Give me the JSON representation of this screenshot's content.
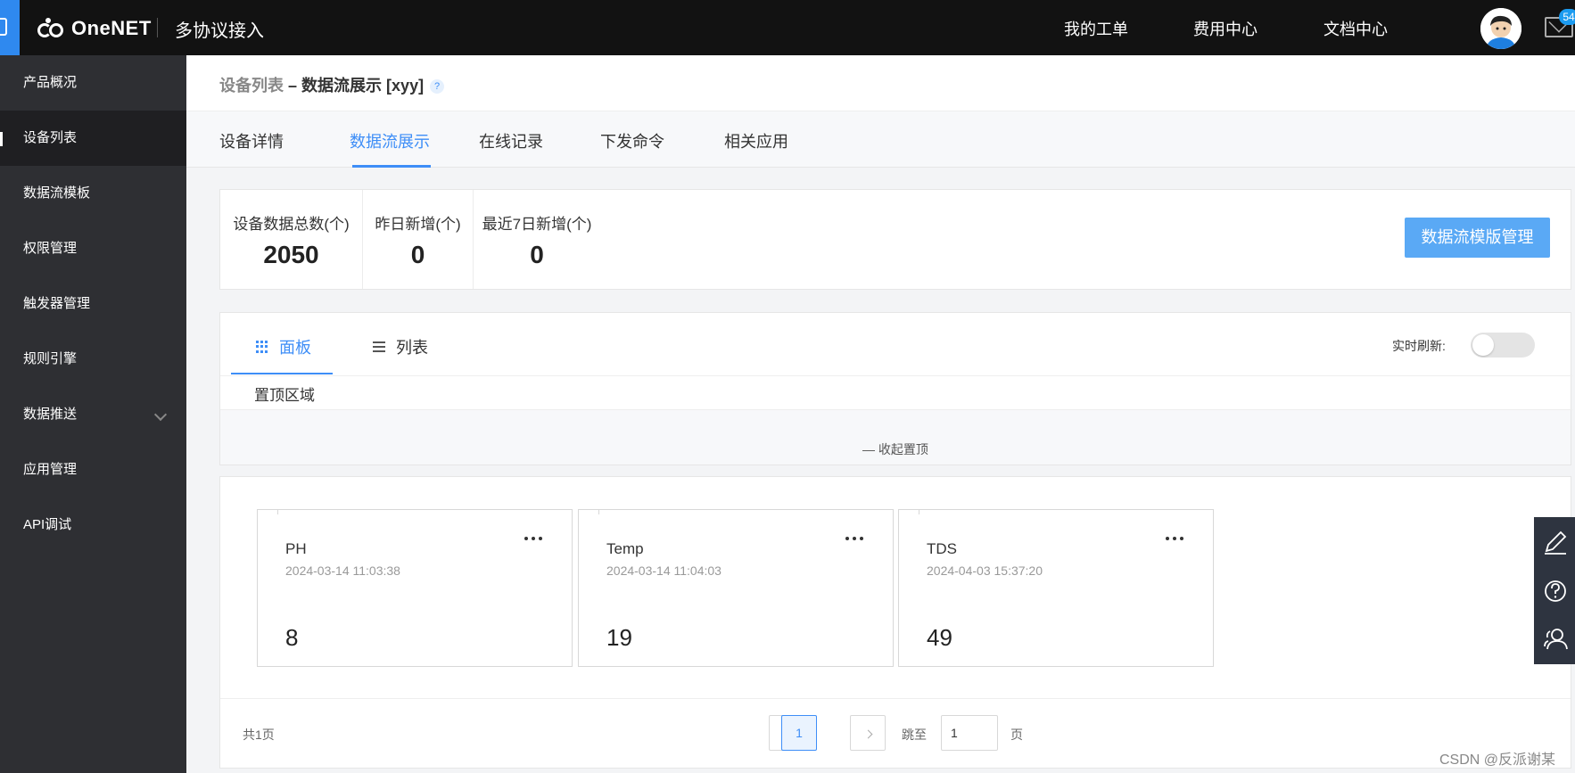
{
  "topbar": {
    "logo": "OneNET",
    "app_title": "多协议接入",
    "nav": [
      "我的工单",
      "费用中心",
      "文档中心"
    ],
    "mail_badge": "54"
  },
  "sidebar": {
    "items": [
      {
        "label": "产品概况"
      },
      {
        "label": "设备列表"
      },
      {
        "label": "数据流模板"
      },
      {
        "label": "权限管理"
      },
      {
        "label": "触发器管理"
      },
      {
        "label": "规则引擎"
      },
      {
        "label": "数据推送"
      },
      {
        "label": "应用管理"
      },
      {
        "label": "API调试"
      }
    ],
    "active_index": 1
  },
  "breadcrumb": {
    "parent": "设备列表",
    "separator": "–",
    "current": "数据流展示 [xyy]",
    "help": "?"
  },
  "tabs": [
    "设备详情",
    "数据流展示",
    "在线记录",
    "下发命令",
    "相关应用"
  ],
  "active_tab": "数据流展示",
  "stats": [
    {
      "label": "设备数据总数(个)",
      "value": "2050"
    },
    {
      "label": "昨日新增(个)",
      "value": "0"
    },
    {
      "label": "最近7日新增(个)",
      "value": "0"
    }
  ],
  "template_button": "数据流模版管理",
  "view_tabs": {
    "board": "面板",
    "list": "列表"
  },
  "realtime_label": "实时刷新:",
  "realtime_on": false,
  "pinned": {
    "title": "置顶区域",
    "collapse": "— 收起置顶"
  },
  "cards": [
    {
      "name": "PH",
      "time": "2024-03-14 11:03:38",
      "value": "8"
    },
    {
      "name": "Temp",
      "time": "2024-03-14 11:04:03",
      "value": "19"
    },
    {
      "name": "TDS",
      "time": "2024-04-03 15:37:20",
      "value": "49"
    }
  ],
  "pagination": {
    "total": "共1页",
    "current": "1",
    "jump_label": "跳至",
    "jump_value": "1",
    "unit": "页"
  },
  "watermark": "CSDN @反派谢某",
  "colors": {
    "accent": "#3e8ef7",
    "topbar": "#121212",
    "sidebar": "#2e2f33",
    "button": "#5aa9f5"
  }
}
